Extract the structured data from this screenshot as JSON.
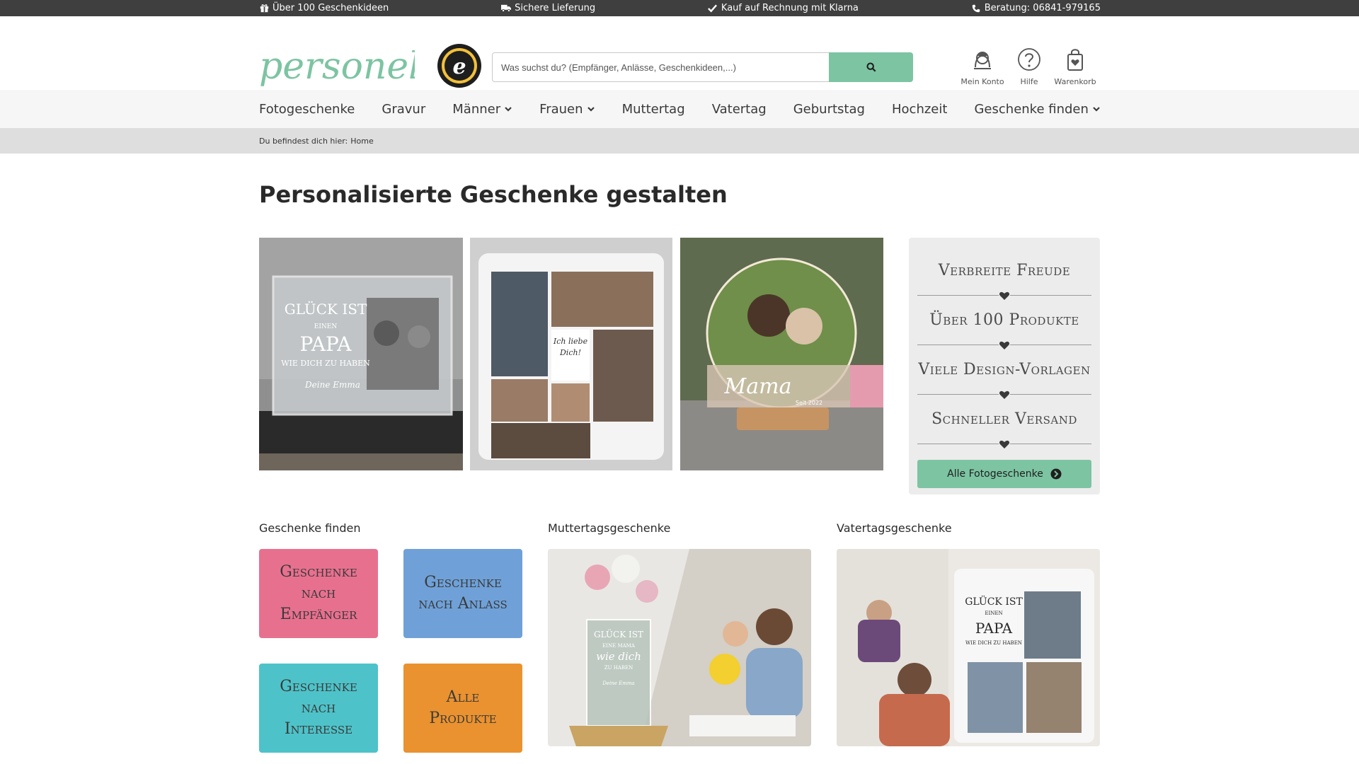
{
  "topbar": {
    "usps": [
      {
        "icon": "gift-icon",
        "label": "Über 100 Geschenkideen"
      },
      {
        "icon": "truck-icon",
        "label": "Sichere Lieferung"
      },
      {
        "icon": "check-icon",
        "label": "Kauf auf Rechnung mit Klarna"
      },
      {
        "icon": "phone-icon",
        "label": "Beratung: 06841-979165"
      }
    ]
  },
  "header": {
    "logo_text": "personello",
    "badge_text": "TRUSTED SHOPS GUARANTEE",
    "search_placeholder": "Was suchst du? (Empfänger, Anlässe, Geschenkideen,...)",
    "account_label": "Mein Konto",
    "help_label": "Hilfe",
    "cart_label": "Warenkorb"
  },
  "nav": {
    "items": [
      {
        "label": "Fotogeschenke",
        "dropdown": false
      },
      {
        "label": "Gravur",
        "dropdown": false
      },
      {
        "label": "Männer",
        "dropdown": true
      },
      {
        "label": "Frauen",
        "dropdown": true
      },
      {
        "label": "Muttertag",
        "dropdown": false
      },
      {
        "label": "Vatertag",
        "dropdown": false
      },
      {
        "label": "Geburtstag",
        "dropdown": false
      },
      {
        "label": "Hochzeit",
        "dropdown": false
      },
      {
        "label": "Geschenke finden",
        "dropdown": true
      }
    ]
  },
  "breadcrumb": {
    "prefix": "Du befindest dich hier:",
    "home": "Home"
  },
  "page": {
    "title": "Personalisierte Geschenke gestalten"
  },
  "hero": {
    "img1_text": [
      "GLÜCK IST",
      "EINEN",
      "PAPA",
      "WIE DICH ZU HABEN",
      "Deine Emma"
    ],
    "img2_text": [
      "Ich liebe",
      "Dich!"
    ],
    "img3_text": [
      "Mama",
      "Seit 2022"
    ]
  },
  "usp_box": {
    "items": [
      "Verbreite Freude",
      "Über 100 Produkte",
      "Viele Design-Vorlagen",
      "Schneller Versand"
    ],
    "cta_label": "Alle Fotogeschenke"
  },
  "sections": {
    "find_title": "Geschenke finden",
    "mother_title": "Muttertagsgeschenke",
    "father_title": "Vatertagsgeschenke",
    "tiles": [
      {
        "label": "Geschenke nach Empfänger",
        "color": "#e8708f"
      },
      {
        "label": "Geschenke nach Anlass",
        "color": "#6fa1d8"
      },
      {
        "label": "Geschenke nach Interesse",
        "color": "#4dc3c9"
      },
      {
        "label": "Alle Produkte",
        "color": "#ea922f"
      }
    ],
    "mother_img_text": [
      "GLÜCK IST",
      "EINE MAMA",
      "wie dich",
      "ZU HABEN",
      "Deine Emma"
    ],
    "father_img_text": [
      "GLÜCK IST",
      "EINEN",
      "PAPA",
      "WIE DICH ZU HABEN"
    ]
  },
  "colors": {
    "brand_green": "#7dc4a2",
    "topbar": "#3f3f3f",
    "nav_bg": "#f6f6f6",
    "crumb_bg": "#dedede"
  }
}
